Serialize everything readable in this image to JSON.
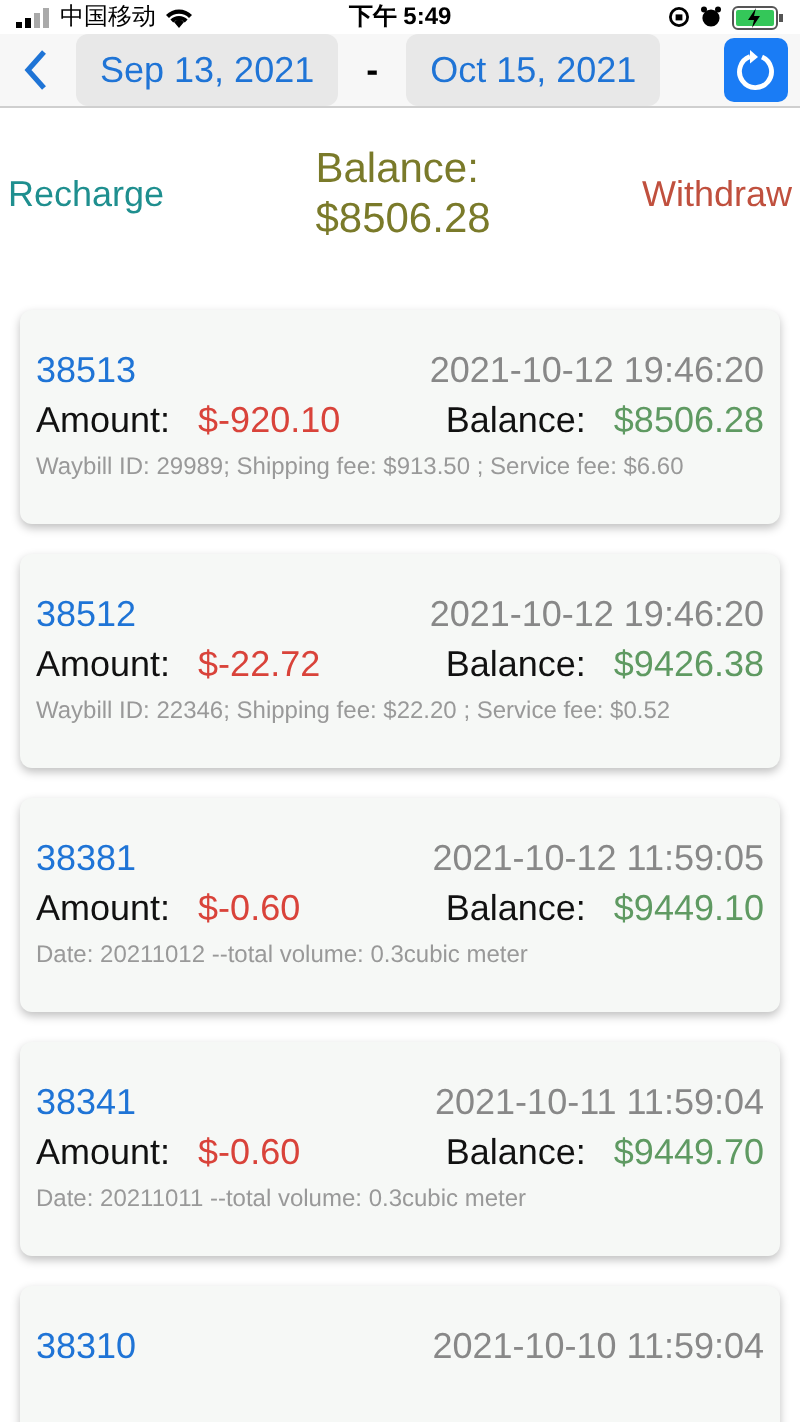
{
  "status_bar": {
    "carrier": "中国移动",
    "time": "下午 5:49",
    "charging": true
  },
  "nav": {
    "start_date": "Sep 13, 2021",
    "separator": "-",
    "end_date": "Oct 15, 2021"
  },
  "summary": {
    "recharge": "Recharge",
    "balance_label": "Balance:",
    "balance_value": "$8506.28",
    "withdraw": "Withdraw"
  },
  "records": [
    {
      "id": "38513",
      "time": "2021-10-12 19:46:20",
      "amount_label": "Amount:",
      "amount": "$-920.10",
      "balance_label": "Balance:",
      "balance": "$8506.28",
      "detail": "Waybill ID: 29989; Shipping fee: $913.50 ; Service fee: $6.60"
    },
    {
      "id": "38512",
      "time": "2021-10-12 19:46:20",
      "amount_label": "Amount:",
      "amount": "$-22.72",
      "balance_label": "Balance:",
      "balance": "$9426.38",
      "detail": "Waybill ID: 22346; Shipping fee: $22.20 ; Service fee: $0.52"
    },
    {
      "id": "38381",
      "time": "2021-10-12 11:59:05",
      "amount_label": "Amount:",
      "amount": "$-0.60",
      "balance_label": "Balance:",
      "balance": "$9449.10",
      "detail": "Date: 20211012 --total volume: 0.3cubic meter"
    },
    {
      "id": "38341",
      "time": "2021-10-11 11:59:04",
      "amount_label": "Amount:",
      "amount": "$-0.60",
      "balance_label": "Balance:",
      "balance": "$9449.70",
      "detail": "Date: 20211011 --total volume: 0.3cubic meter"
    },
    {
      "id": "38310",
      "time": "2021-10-10 11:59:04"
    }
  ]
}
